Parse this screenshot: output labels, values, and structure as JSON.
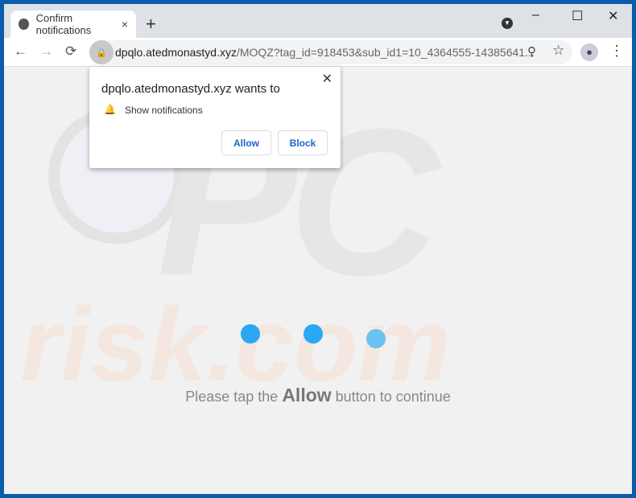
{
  "tab": {
    "title": "Confirm notifications",
    "close": "×",
    "new_tab": "+"
  },
  "window": {
    "minimize": "–",
    "maximize": "☐",
    "close": "✕"
  },
  "toolbar": {
    "back": "←",
    "forward": "→",
    "reload": "⟳",
    "url_host": "dpqlo.atedmonastyd.xyz",
    "url_path": "/MOQZ?tag_id=918453&sub_id1=10_4364555-14385641...",
    "zoom": "⚲",
    "star": "☆",
    "menu": "⋮"
  },
  "popup": {
    "title": "dpqlo.atedmonastyd.xyz wants to",
    "permission": "Show notifications",
    "allow": "Allow",
    "block": "Block",
    "close": "✕"
  },
  "page": {
    "msg_before": "Please tap the ",
    "msg_bold": "Allow",
    "msg_after": " button to continue",
    "watermark_top": "PC",
    "watermark_bottom": "risk.com"
  },
  "colors": {
    "dot": "#2aa8f5",
    "accent": "#1a66c8",
    "frame": "#0b5cab"
  }
}
